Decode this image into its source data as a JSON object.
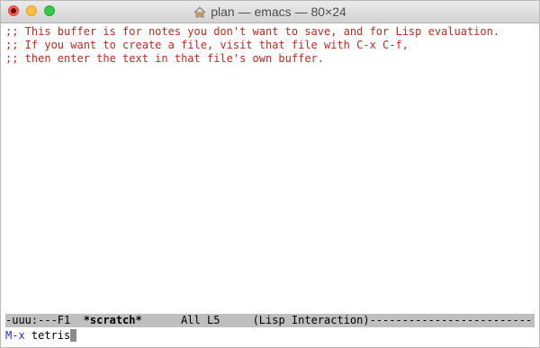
{
  "window": {
    "title": "plan — emacs — 80×24",
    "title_icon": "home-icon"
  },
  "buffer": {
    "lines": [
      ";; This buffer is for notes you don't want to save, and for Lisp evaluation.",
      ";; If you want to create a file, visit that file with C-x C-f,",
      ";; then enter the text in that file's own buffer."
    ]
  },
  "modeline": {
    "status": "-uuu:---F1  ",
    "buffer_name": "*scratch*",
    "position": "      All L5     ",
    "mode": "(Lisp Interaction)",
    "fill": "-------------------------"
  },
  "minibuffer": {
    "prompt": "M-x",
    "input": " tetris"
  },
  "colors": {
    "comment": "#c4281c",
    "modeline_bg": "#bfbfbf",
    "prompt": "#2a2ae0",
    "cursor": "#8c8c8c"
  }
}
